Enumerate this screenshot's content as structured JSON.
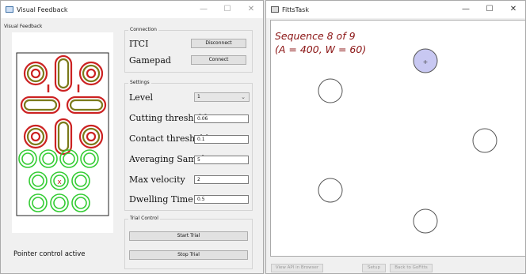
{
  "visual_feedback": {
    "window_title": "Visual Feedback",
    "panel_title": "Visual Feedback",
    "marker_label": "x",
    "status": "Pointer control active",
    "connection": {
      "title": "Connection",
      "itci_label": "ITCI",
      "itci_button": "Disconnect",
      "gamepad_label": "Gamepad",
      "gamepad_button": "Connect"
    },
    "settings": {
      "title": "Settings",
      "level_label": "Level",
      "level_value": "1",
      "cutting_label": "Cutting threshold",
      "cutting_value": "0.06",
      "contact_label": "Contact threshold",
      "contact_value": "0.1",
      "averaging_label": "Averaging Samples",
      "averaging_value": "5",
      "velocity_label": "Max velocity",
      "velocity_value": "2",
      "dwelling_label": "Dwelling Time",
      "dwelling_value": "0.5"
    },
    "trial": {
      "title": "Trial Control",
      "start_button": "Start Trial",
      "stop_button": "Stop Trial"
    }
  },
  "fitts": {
    "window_title": "FittsTask",
    "sequence_line1": "Sequence 8 of 9",
    "sequence_line2": "(A = 400, W = 60)",
    "target_marker": "+",
    "buttons": {
      "view_api": "View API in Browser",
      "setup": "Setup",
      "back": "Back to GoFitts"
    }
  },
  "colors": {
    "key_red": "#cc2222",
    "key_olive": "#7a7a1a",
    "key_green": "#33cc33",
    "target_fill": "#c8c8f2",
    "sequence_text": "#8b1414"
  }
}
